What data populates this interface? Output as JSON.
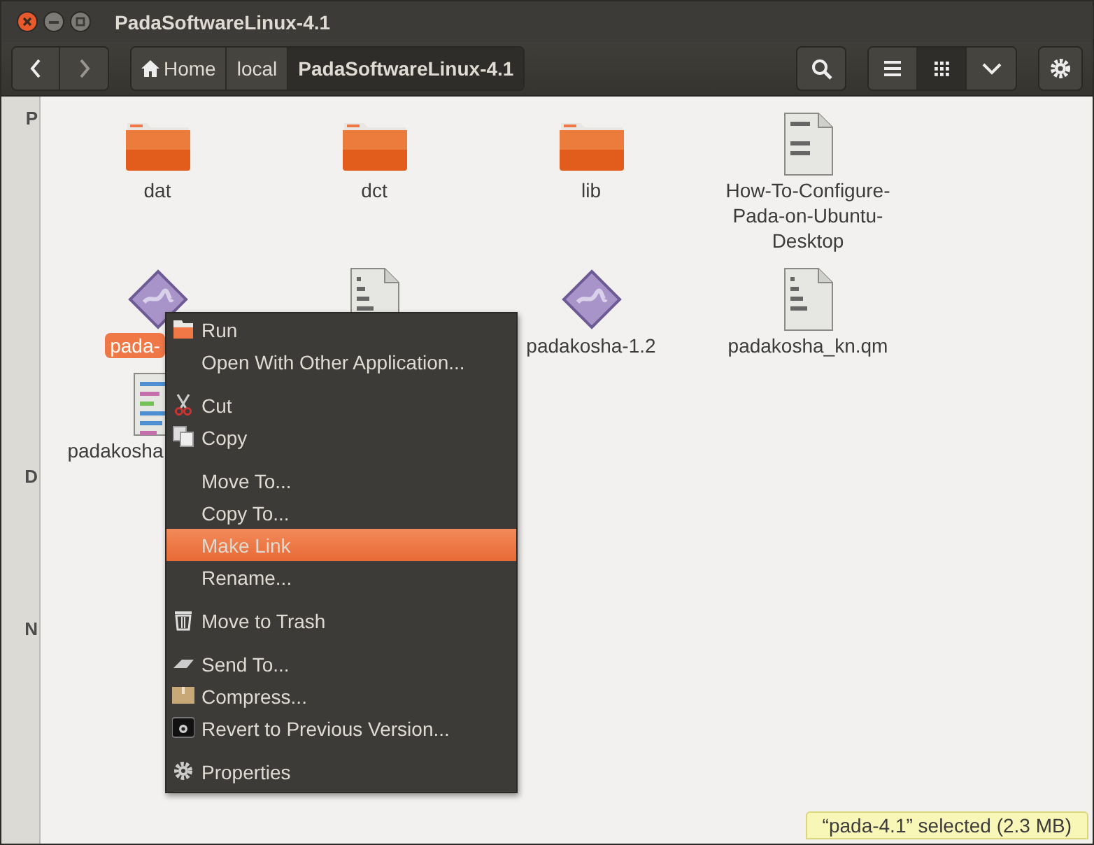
{
  "window": {
    "title": "PadaSoftwareLinux-4.1"
  },
  "breadcrumbs": [
    {
      "label": "Home",
      "selected": false,
      "kind": "home"
    },
    {
      "label": "local",
      "selected": false,
      "kind": "plain"
    },
    {
      "label": "PadaSoftwareLinux-4.1",
      "selected": true,
      "kind": "plain"
    }
  ],
  "view_buttons": [
    {
      "kind": "list",
      "selected": false
    },
    {
      "kind": "grid",
      "selected": true
    },
    {
      "kind": "dropdown",
      "selected": false
    }
  ],
  "sidebar": {
    "headings": [
      "P",
      "D",
      "N"
    ]
  },
  "files": [
    {
      "kind": "folder",
      "label": "dat",
      "selected": false
    },
    {
      "kind": "folder",
      "label": "dct",
      "selected": false
    },
    {
      "kind": "folder",
      "label": "lib",
      "selected": false
    },
    {
      "kind": "text",
      "label": "How-To-Configure-Pada-on-Ubuntu-Desktop",
      "selected": false
    },
    {
      "kind": "executable",
      "label": "pada-",
      "selected": true
    },
    {
      "kind": "binary"
    },
    {
      "kind": "executable",
      "label": "padakosha-1.2",
      "selected": false
    },
    {
      "kind": "binary",
      "label": "padakosha_kn.qm",
      "selected": false
    },
    {
      "kind": "source",
      "label": "padakosha",
      "selected": false
    }
  ],
  "context_menu": [
    {
      "kind": "item",
      "label": "Run",
      "selected": false
    },
    {
      "kind": "item",
      "label": "Open With Other Application...",
      "selected": false
    },
    {
      "kind": "separator"
    },
    {
      "kind": "item",
      "label": "Cut",
      "selected": false
    },
    {
      "kind": "item",
      "label": "Copy",
      "selected": false
    },
    {
      "kind": "separator"
    },
    {
      "kind": "item",
      "label": "Move To...",
      "selected": false
    },
    {
      "kind": "item",
      "label": "Copy To...",
      "selected": false
    },
    {
      "kind": "item",
      "label": "Make Link",
      "selected": true
    },
    {
      "kind": "item",
      "label": "Rename...",
      "selected": false
    },
    {
      "kind": "separator"
    },
    {
      "kind": "item",
      "label": "Move to Trash",
      "selected": false
    },
    {
      "kind": "separator"
    },
    {
      "kind": "item",
      "label": "Send To...",
      "selected": false
    },
    {
      "kind": "item",
      "label": "Compress...",
      "selected": false
    },
    {
      "kind": "item",
      "label": "Revert to Previous Version...",
      "selected": false
    },
    {
      "kind": "separator"
    },
    {
      "kind": "item",
      "label": "Properties",
      "selected": false
    }
  ],
  "status_bar": "“pada-4.1” selected (2.3 MB)"
}
